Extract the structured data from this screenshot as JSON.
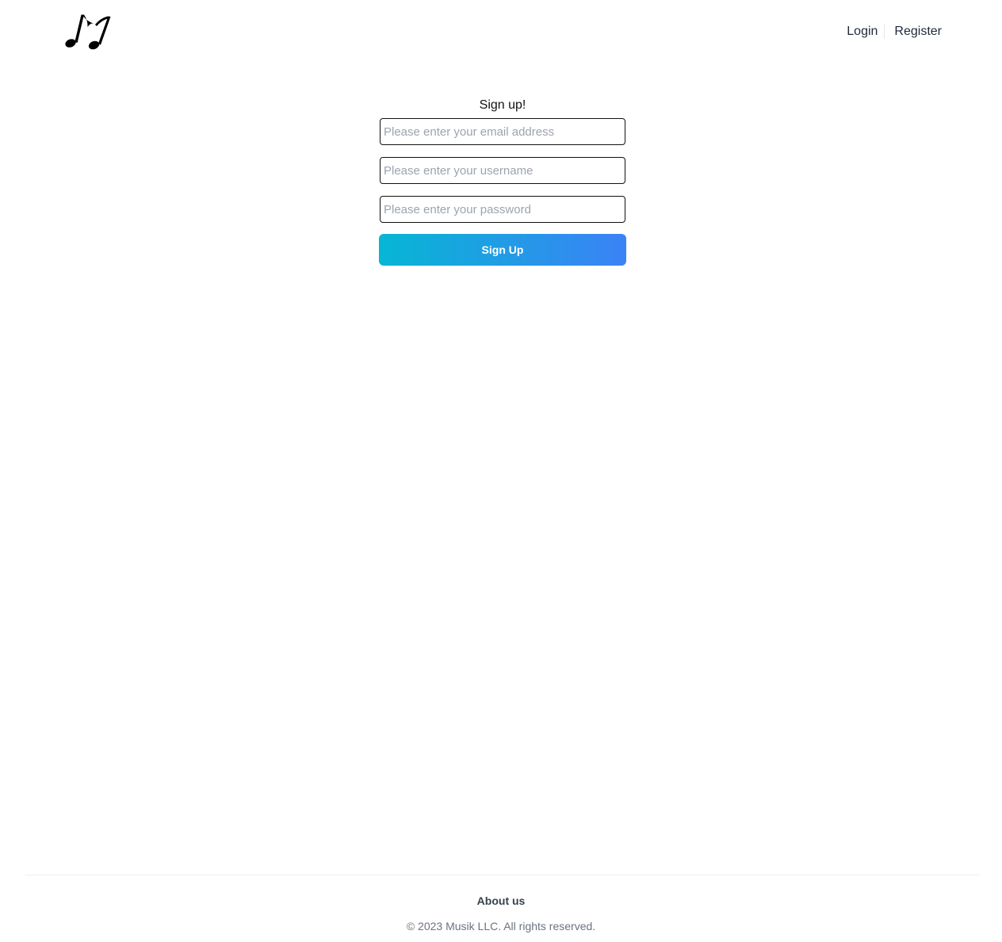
{
  "header": {
    "logo_icon": "music-note-icon",
    "nav": {
      "login_label": "Login",
      "register_label": "Register"
    }
  },
  "form": {
    "title": "Sign up!",
    "email_placeholder": "Please enter your email address",
    "username_placeholder": "Please enter your username",
    "password_placeholder": "Please enter your password",
    "submit_label": "Sign Up"
  },
  "footer": {
    "about_label": "About us",
    "copyright": "© 2023 Musik LLC. All rights reserved."
  },
  "colors": {
    "button_gradient_start": "#06b6d4",
    "button_gradient_end": "#3b82f6",
    "text": "#111111",
    "muted": "#6b7280"
  }
}
